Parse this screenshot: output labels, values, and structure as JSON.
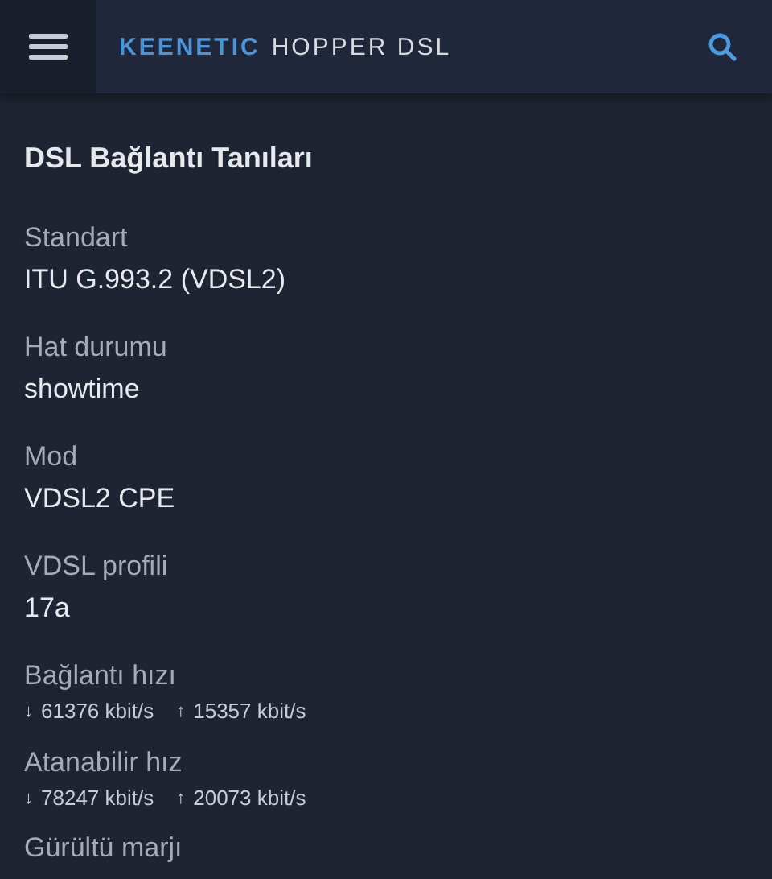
{
  "header": {
    "brand": "KEENETIC",
    "model": "HOPPER DSL"
  },
  "title": "DSL Bağlantı Tanıları",
  "fields": [
    {
      "kind": "text",
      "label": "Standart",
      "value": "ITU G.993.2 (VDSL2)"
    },
    {
      "kind": "text",
      "label": "Hat durumu",
      "value": "showtime"
    },
    {
      "kind": "text",
      "label": "Mod",
      "value": "VDSL2 CPE"
    },
    {
      "kind": "text",
      "label": "VDSL profili",
      "value": "17a"
    },
    {
      "kind": "speed",
      "label": "Bağlantı hızı",
      "down_arrow": "↓",
      "down": "61376 kbit/s",
      "up_arrow": "↑",
      "up": "15357 kbit/s"
    },
    {
      "kind": "speed",
      "label": "Atanabilir hız",
      "down_arrow": "↓",
      "down": "78247 kbit/s",
      "up_arrow": "↑",
      "up": "20073 kbit/s"
    },
    {
      "kind": "label",
      "label": "Gürültü marjı"
    }
  ]
}
